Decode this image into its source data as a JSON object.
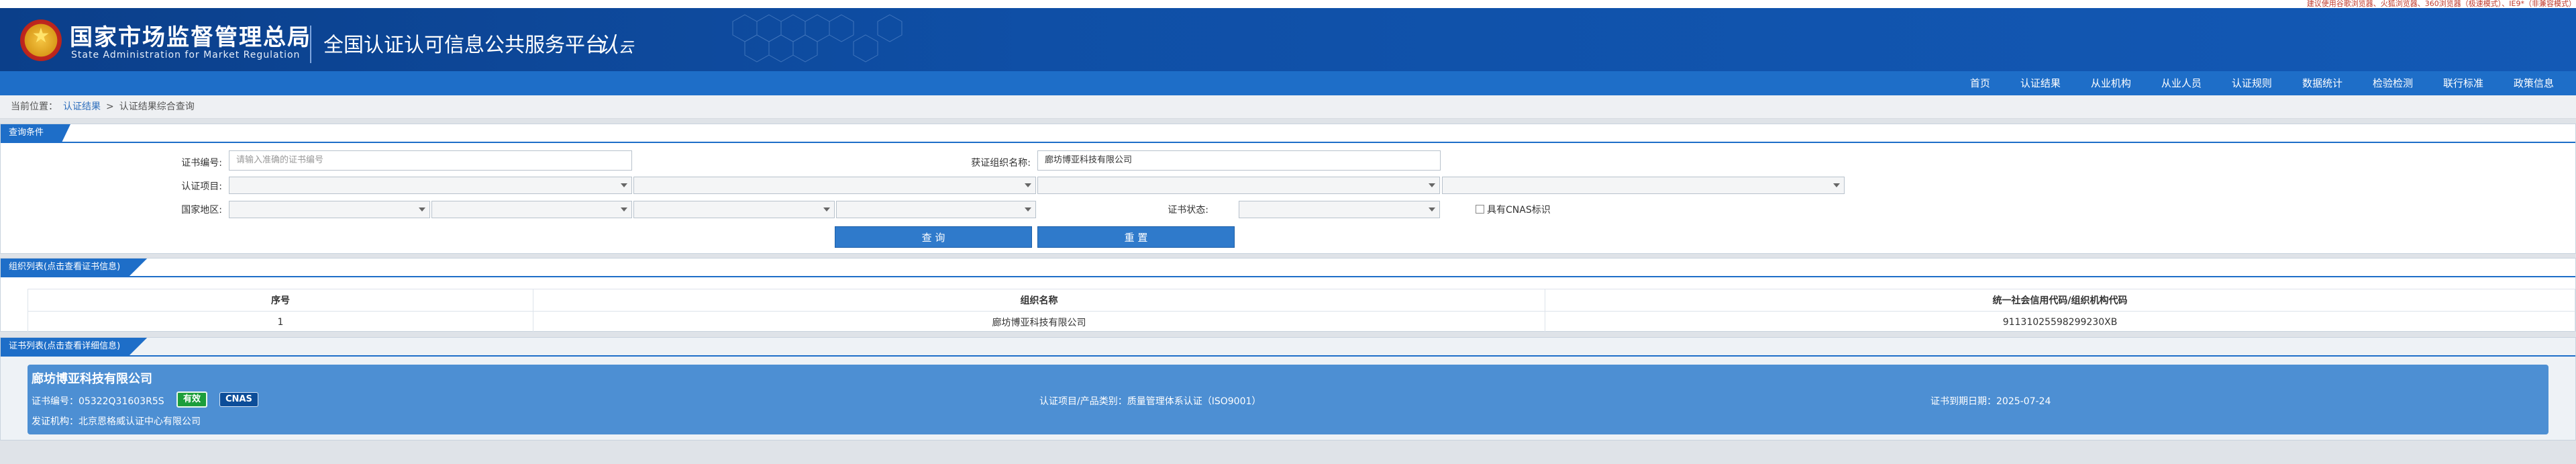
{
  "marquee": "建议使用谷歌浏览器、火狐浏览器、360浏览器（极速模式）、IE9*（非兼容模式）",
  "header": {
    "org_name_cn": "国家市场监督管理总局",
    "org_name_en": "State Administration  for  Market Regulation",
    "platform_title": "全国认证认可信息公共服务平台",
    "logo_text": "认云"
  },
  "nav": {
    "items": [
      "首页",
      "认证结果",
      "从业机构",
      "从业人员",
      "认证规则",
      "数据统计",
      "检验检测",
      "联行标准",
      "政策信息"
    ]
  },
  "breadcrumb": {
    "label": "当前位置：",
    "level1": "认证结果",
    "separator": ">",
    "level2": "认证结果综合查询"
  },
  "query": {
    "section_title": "查询条件",
    "cert_no_label": "证书编号:",
    "cert_no_placeholder": "请输入准确的证书编号",
    "org_name_label": "获证组织名称:",
    "org_name_value": "廊坊博亚科技有限公司",
    "cert_project_label": "认证项目:",
    "region_label": "国家地区:",
    "cert_status_label": "证书状态:",
    "cnas_checkbox_label": "具有CNAS标识",
    "query_button": "查 询",
    "reset_button": "重 置"
  },
  "org_list": {
    "section_title": "组织列表(点击查看证书信息)",
    "columns": [
      "序号",
      "组织名称",
      "统一社会信用代码/组织机构代码"
    ],
    "rows": [
      {
        "index": "1",
        "name": "廊坊博亚科技有限公司",
        "code": "91131025598299230XB"
      }
    ]
  },
  "cert_list": {
    "section_title": "证书列表(点击查看详细信息)",
    "cards": [
      {
        "org_name": "廊坊博亚科技有限公司",
        "cert_no_label": "证书编号：",
        "cert_no": "05322Q31603R5S",
        "status_badge": "有效",
        "cnas_badge": "CNAS",
        "project_label": "认证项目/产品类别：",
        "project": "质量管理体系认证（ISO9001）",
        "expiry_label": "证书到期日期：",
        "expiry": "2025-07-24",
        "issuer_label": "发证机构：",
        "issuer": "北京恩格威认证中心有限公司"
      }
    ]
  },
  "colors": {
    "header_blue": "#0f4fa6",
    "nav_blue": "#1e6ec8",
    "card_blue": "#4d8fd3",
    "valid_green": "#1c9e3b",
    "cnas_navy": "#0c4d99"
  }
}
